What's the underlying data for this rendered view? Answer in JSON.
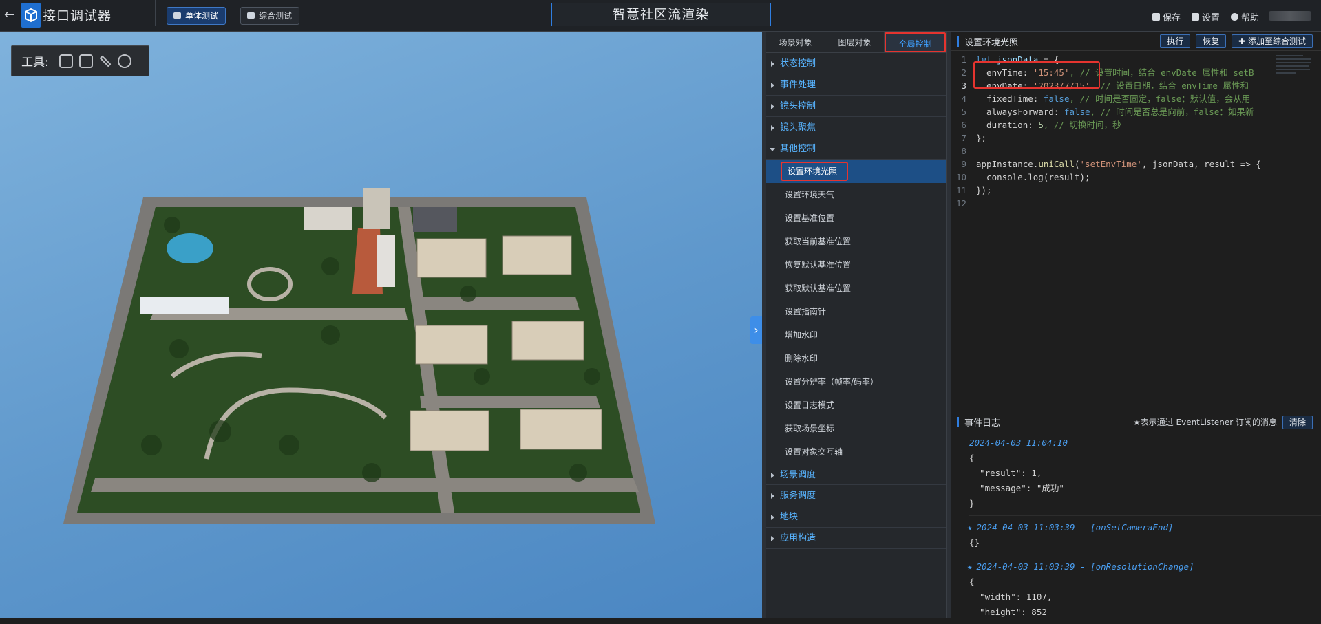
{
  "app": {
    "title": "接口调试器",
    "tabs": [
      "单体测试",
      "综合测试"
    ],
    "scene_name": "智慧社区流渲染",
    "actions": [
      "保存",
      "设置",
      "帮助"
    ]
  },
  "viewport": {
    "toolbox_label": "工具:",
    "tools": [
      "locate-icon",
      "scan-icon",
      "pen-icon",
      "settings-icon"
    ]
  },
  "mid": {
    "tabs": [
      "场景对象",
      "图层对象",
      "全局控制"
    ],
    "groups_before": [
      "状态控制",
      "事件处理",
      "镜头控制",
      "镜头聚焦"
    ],
    "open_group": "其他控制",
    "items": [
      "设置环境光照",
      "设置环境天气",
      "设置基准位置",
      "获取当前基准位置",
      "恢复默认基准位置",
      "获取默认基准位置",
      "设置指南针",
      "增加水印",
      "删除水印",
      "设置分辨率（帧率/码率）",
      "设置日志模式",
      "获取场景坐标",
      "设置对象交互轴"
    ],
    "groups_after": [
      "场景调度",
      "服务调度",
      "地块",
      "应用构造"
    ]
  },
  "editor": {
    "title": "设置环境光照",
    "buttons": [
      "执行",
      "恢复",
      "添加至综合测试"
    ],
    "lines": {
      "l1": {
        "kw": "let",
        "name": " jsonData",
        "rest": " = {"
      },
      "l2": {
        "key": "  envTime: ",
        "str": "'15:45'",
        "comment": ", // 设置时间，结合 envDate 属性和 setB"
      },
      "l3": {
        "key": "  envDate: ",
        "str": "'2023/7/15'",
        "comment": ", // 设置日期，结合 envTime 属性和"
      },
      "l4": {
        "key": "  fixedTime: ",
        "val": "false",
        "comment": ", // 时间是否固定，false：默认值，会从用"
      },
      "l5": {
        "key": "  alwaysForward: ",
        "val": "false",
        "comment": ", // 时间是否总是向前，false：如果新"
      },
      "l6": {
        "key": "  duration: ",
        "val": "5",
        "comment": ", // 切换时间，秒"
      },
      "l7": "};",
      "l9a": "appInstance.",
      "l9b": "uniCall",
      "l9c": "(",
      "l9d": "'setEnvTime'",
      "l9e": ", jsonData, result => {",
      "l10": "  console.log(result);",
      "l11": "});"
    },
    "line_numbers": [
      "1",
      "2",
      "3",
      "4",
      "5",
      "6",
      "7",
      "8",
      "9",
      "10",
      "11",
      "12"
    ]
  },
  "log": {
    "title": "事件日志",
    "hint": "★表示通过 EventListener 订阅的消息",
    "clear": "清除",
    "e1_ts": "2024-04-03 11:04:10",
    "e1_lines": [
      "{",
      "  \"result\": 1,",
      "  \"message\": \"成功\"",
      "}"
    ],
    "e2_ts": "2024-04-03 11:03:39 - [onSetCameraEnd]",
    "e2_body": "{}",
    "e3_ts": "2024-04-03 11:03:39 - [onResolutionChange]",
    "e3_lines": [
      "{",
      "  \"width\": 1107,",
      "  \"height\": 852"
    ]
  }
}
